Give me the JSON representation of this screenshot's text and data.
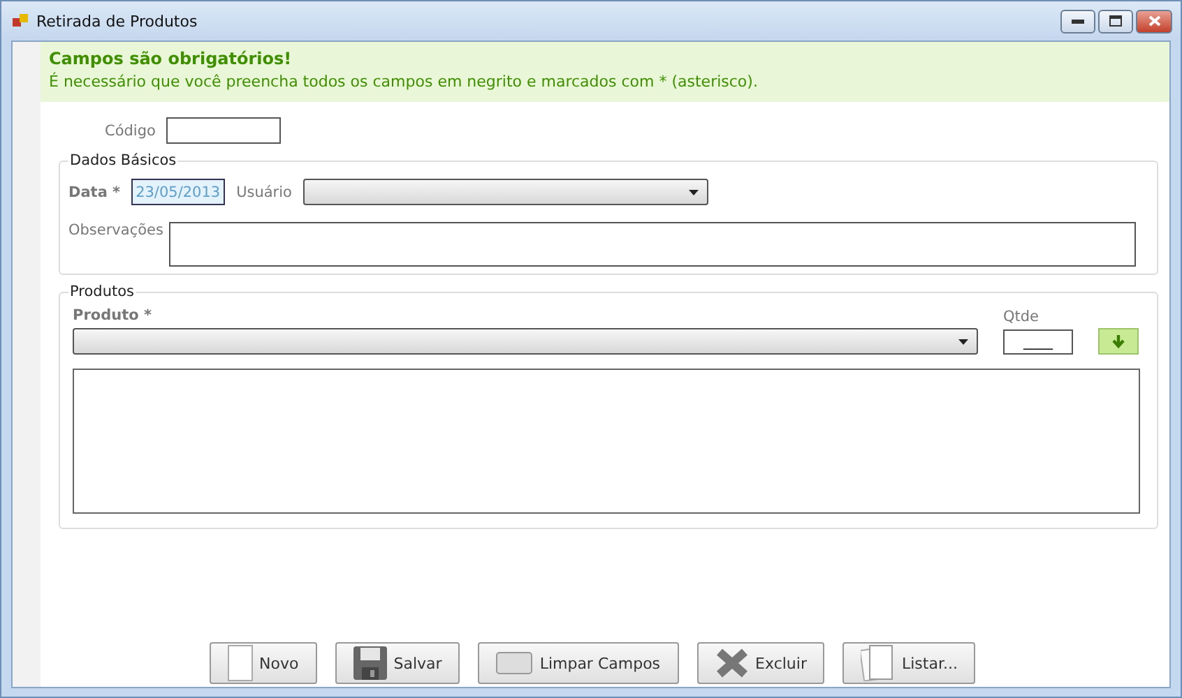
{
  "window": {
    "title": "Retirada de Produtos"
  },
  "banner": {
    "title": "Campos são obrigatórios!",
    "message": "É necessário que você preencha todos os campos em negrito e marcados com * (asterisco)."
  },
  "codigo": {
    "label": "Código"
  },
  "dados_basicos": {
    "title": "Dados Básicos",
    "data": {
      "label": "Data *",
      "value": "23/05/2013",
      "focused": true
    },
    "usuario": {
      "label": "Usuário"
    },
    "observacoes": {
      "label": "Observações"
    }
  },
  "produtos": {
    "title": "Produtos",
    "produto": {
      "label": "Produto *"
    },
    "qtde": {
      "label": "Qtde",
      "value": "____"
    }
  },
  "buttons": [
    {
      "label": "Novo",
      "kind": "new"
    },
    {
      "label": "Salvar",
      "kind": "save"
    },
    {
      "label": "Limpar Campos",
      "kind": "clear"
    },
    {
      "label": "Excluir",
      "kind": "delete"
    },
    {
      "label": "Listar...",
      "kind": "list"
    }
  ]
}
